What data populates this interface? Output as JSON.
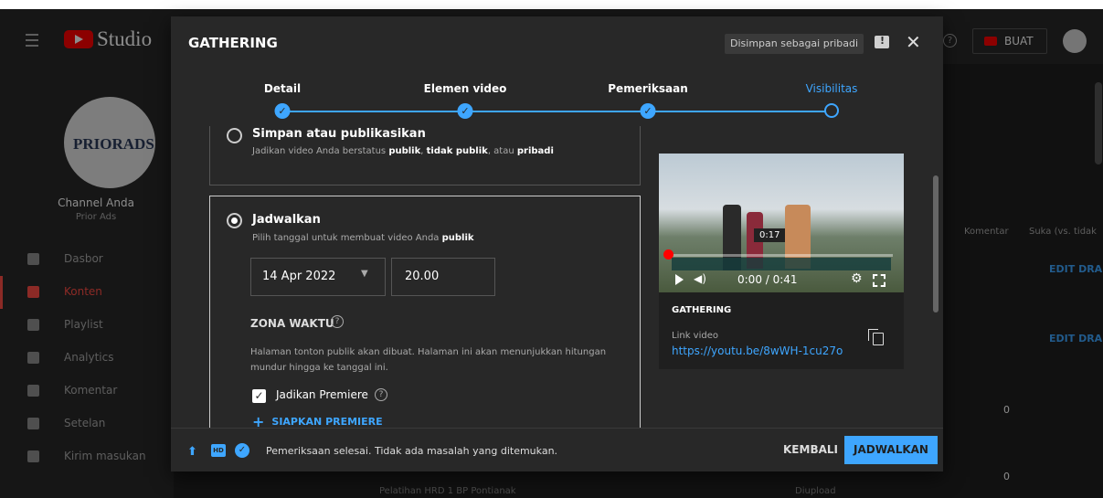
{
  "app": {
    "studio_label": "Studio",
    "create_label": "BUAT"
  },
  "sidebar": {
    "channel_logo_text": "PRIORADS",
    "channel_title": "Channel Anda",
    "channel_sub": "Prior Ads",
    "items": [
      {
        "label": "Dasbor",
        "icon": "dashboard-icon"
      },
      {
        "label": "Konten",
        "icon": "content-icon"
      },
      {
        "label": "Playlist",
        "icon": "playlist-icon"
      },
      {
        "label": "Analytics",
        "icon": "analytics-icon"
      },
      {
        "label": "Komentar",
        "icon": "comment-icon"
      },
      {
        "label": "Setelan",
        "icon": "settings-icon"
      },
      {
        "label": "Kirim masukan",
        "icon": "feedback-icon"
      }
    ]
  },
  "background": {
    "col_comments": "Komentar",
    "col_likes": "Suka (vs. tidak",
    "edit_draft": "EDIT DRA",
    "zero": "0",
    "row_title": "Pelatihan HRD 1 BP Pontianak",
    "row_status": "Diupload"
  },
  "dialog": {
    "title": "GATHERING",
    "saved_badge": "Disimpan sebagai pribadi",
    "steps": [
      {
        "label": "Detail"
      },
      {
        "label": "Elemen video"
      },
      {
        "label": "Pemeriksaan"
      },
      {
        "label": "Visibilitas"
      }
    ],
    "save_option": {
      "title": "Simpan atau publikasikan",
      "desc_pre": "Jadikan video Anda berstatus ",
      "desc_b1": "publik",
      "desc_mid1": ", ",
      "desc_b2": "tidak publik",
      "desc_mid2": ", atau ",
      "desc_b3": "pribadi"
    },
    "schedule_option": {
      "title": "Jadwalkan",
      "desc_pre": "Pilih tanggal untuk membuat video Anda ",
      "desc_b": "publik",
      "date": "14 Apr 2022",
      "time": "20.00",
      "timezone_label": "ZONA WAKTU",
      "timezone_desc": "Halaman tonton publik akan dibuat. Halaman ini akan menunjukkan hitungan mundur hingga ke tanggal ini.",
      "premiere_label": "Jadikan Premiere",
      "setup_premiere": "SIAPKAN PREMIERE"
    },
    "preview": {
      "tooltip_time": "0:17",
      "time_display": "0:00 / 0:41",
      "video_title": "GATHERING",
      "link_label": "Link video",
      "link": "https://youtu.be/8wWH-1cu27o"
    },
    "footer": {
      "status": "Pemeriksaan selesai. Tidak ada masalah yang ditemukan.",
      "back": "KEMBALI",
      "schedule": "JADWALKAN",
      "hd_text": "HD"
    }
  },
  "colors": {
    "accent": "#3ea6ff",
    "brand": "#ff0000",
    "active_nav": "#ff4e45",
    "dialog_bg": "#282828"
  }
}
